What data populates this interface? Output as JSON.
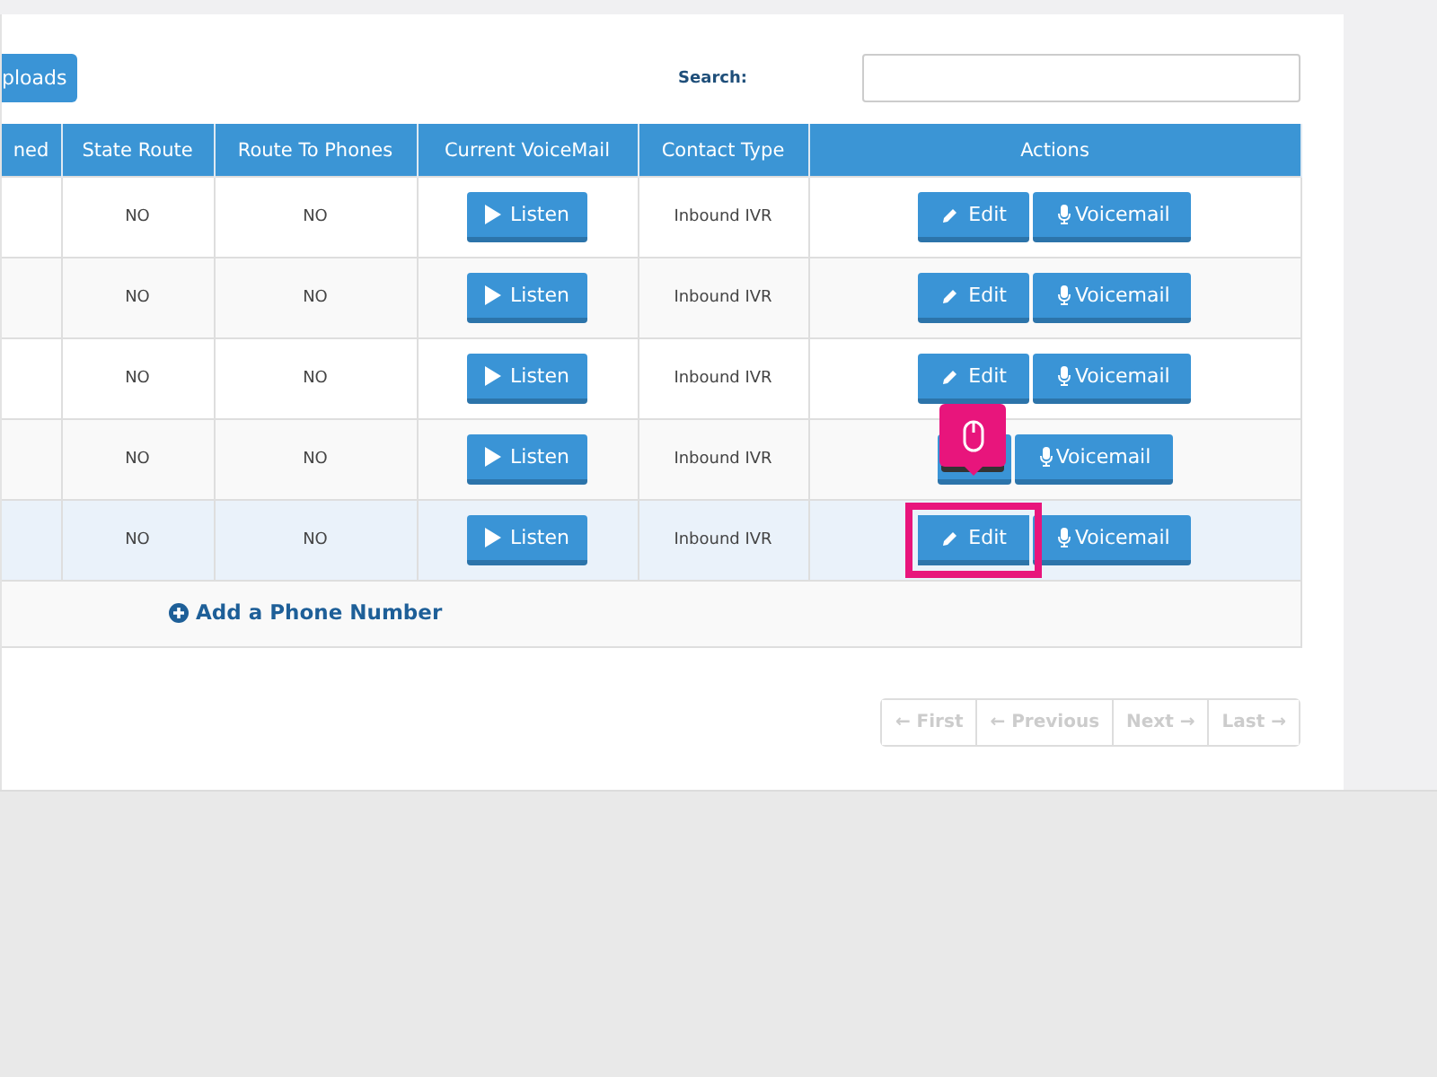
{
  "toolbar": {
    "uploads_button": "ploads",
    "search_label": "Search:"
  },
  "table": {
    "columns": [
      "ned",
      "State Route",
      "Route To Phones",
      "Current VoiceMail",
      "Contact Type",
      "Actions"
    ],
    "rows": [
      {
        "state_route": "NO",
        "route_to_phones": "NO",
        "voicemail_button": "Listen",
        "contact_type": "Inbound IVR",
        "edit_button": "Edit",
        "record_button": "Voicemail",
        "hovered": false
      },
      {
        "state_route": "NO",
        "route_to_phones": "NO",
        "voicemail_button": "Listen",
        "contact_type": "Inbound IVR",
        "edit_button": "Edit",
        "record_button": "Voicemail",
        "hovered": false
      },
      {
        "state_route": "NO",
        "route_to_phones": "NO",
        "voicemail_button": "Listen",
        "contact_type": "Inbound IVR",
        "edit_button": "Edit",
        "record_button": "Voicemail",
        "hovered": false
      },
      {
        "state_route": "NO",
        "route_to_phones": "NO",
        "voicemail_button": "Listen",
        "contact_type": "Inbound IVR",
        "record_button": "Voicemail",
        "hovered": false
      },
      {
        "state_route": "NO",
        "route_to_phones": "NO",
        "voicemail_button": "Listen",
        "contact_type": "Inbound IVR",
        "edit_button": "Edit",
        "record_button": "Voicemail",
        "hovered": true
      }
    ],
    "add_link": "Add a Phone Number"
  },
  "pagination": [
    {
      "label": "← First",
      "disabled": true
    },
    {
      "label": "← Previous",
      "disabled": true
    },
    {
      "label": "Next →",
      "disabled": true
    },
    {
      "label": "Last →",
      "disabled": true
    }
  ]
}
